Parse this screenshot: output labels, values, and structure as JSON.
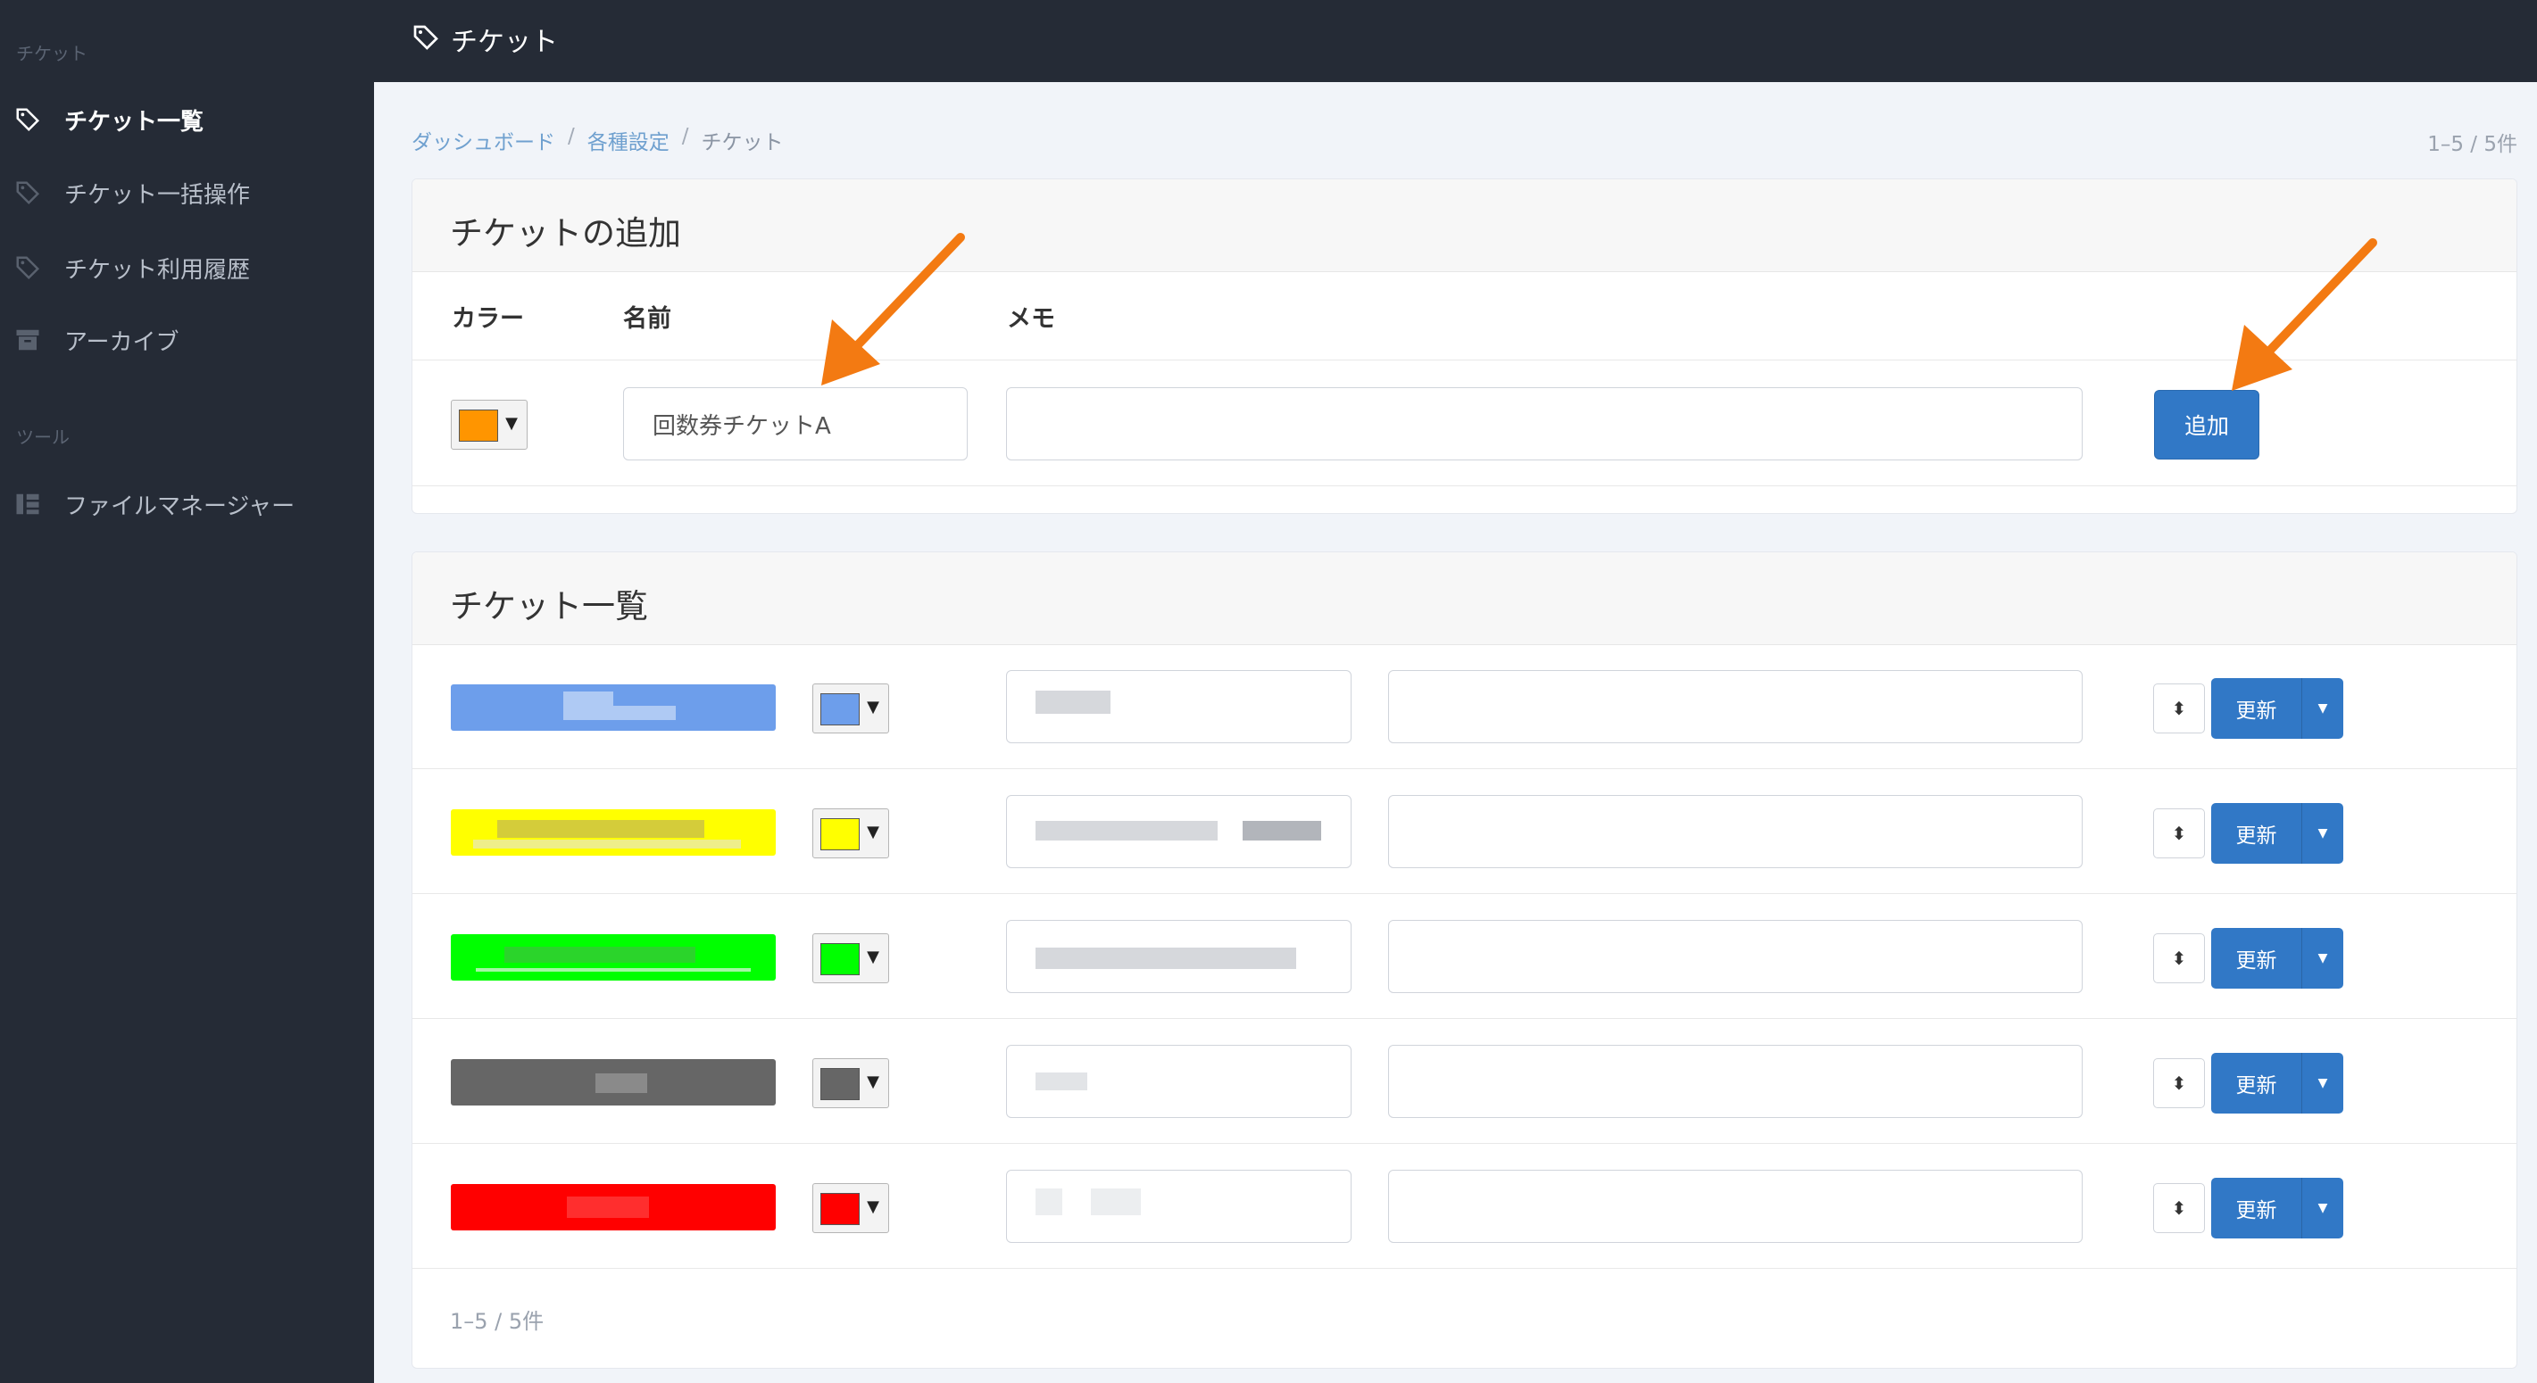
{
  "sidebar": {
    "section_ticket": "チケット",
    "section_tools": "ツール",
    "items": [
      {
        "label": "チケット一覧",
        "icon": "tag-icon",
        "active": true
      },
      {
        "label": "チケット一括操作",
        "icon": "tag-icon"
      },
      {
        "label": "チケット利用履歴",
        "icon": "tag-icon"
      },
      {
        "label": "アーカイブ",
        "icon": "archive-icon"
      },
      {
        "label": "ファイルマネージャー",
        "icon": "file-tree-icon"
      }
    ]
  },
  "topbar": {
    "title": "チケット",
    "icon": "tag-icon"
  },
  "breadcrumb": {
    "items": [
      "ダッシュボード",
      "各種設定",
      "チケット"
    ],
    "separator": "/"
  },
  "pagination_count": "1–5 / 5件",
  "add_card": {
    "title": "チケットの追加",
    "col_color": "カラー",
    "col_name": "名前",
    "col_memo": "メモ",
    "color": "#ff9500",
    "name_value": "回数券チケットA",
    "memo_value": "",
    "add_button": "追加",
    "dropdown_arrow": "▼"
  },
  "list_card": {
    "title": "チケット一覧",
    "update_button": "更新",
    "sort_icon": "sort-icon",
    "caret_icon": "caret-down-icon",
    "rows": [
      {
        "color": "#6d9eeb"
      },
      {
        "color": "#ffff00"
      },
      {
        "color": "#00ff00"
      },
      {
        "color": "#666666"
      },
      {
        "color": "#ff0000"
      }
    ],
    "footer_count": "1–5 / 5件"
  },
  "colors": {
    "sidebar_bg": "#252b36",
    "primary": "#3178c6",
    "annotation_arrow": "#f37a12"
  }
}
